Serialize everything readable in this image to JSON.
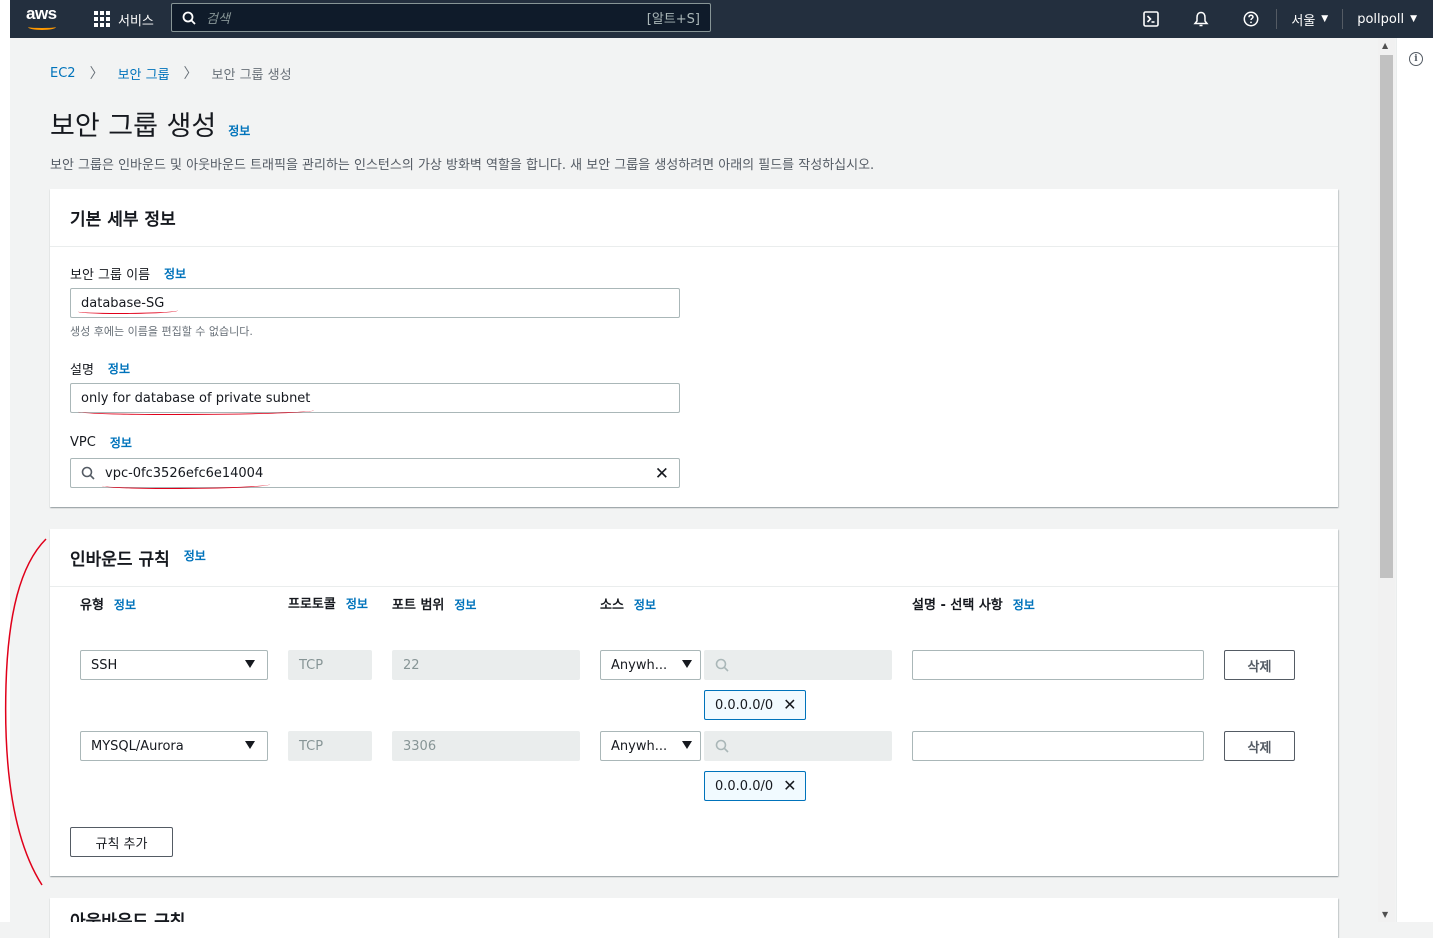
{
  "topbar": {
    "logo": "aws",
    "services_label": "서비스",
    "search_placeholder": "검색",
    "search_shortcut": "[알트+S]",
    "region": "서울",
    "user": "pollpoll"
  },
  "breadcrumb": {
    "root": "EC2",
    "parent": "보안 그룹",
    "current": "보안 그룹 생성"
  },
  "page": {
    "title": "보안 그룹 생성",
    "info": "정보",
    "description": "보안 그룹은 인바운드 및 아웃바운드 트래픽을 관리하는 인스턴스의 가상 방화벽 역할을 합니다. 새 보안 그룹을 생성하려면 아래의 필드를 작성하십시오."
  },
  "basic": {
    "title": "기본 세부 정보",
    "name_label": "보안 그룹 이름",
    "name_value": "database-SG",
    "name_hint": "생성 후에는 이름을 편집할 수 없습니다.",
    "desc_label": "설명",
    "desc_value": "only for database of private subnet",
    "vpc_label": "VPC",
    "vpc_value": "vpc-0fc3526efc6e14004",
    "info": "정보"
  },
  "inbound": {
    "title": "인바운드 규칙",
    "info": "정보",
    "columns": {
      "type": "유형",
      "protocol": "프로토콜",
      "port": "포트 범위",
      "source": "소스",
      "description": "설명 - 선택 사항"
    },
    "rules": [
      {
        "type": "SSH",
        "protocol": "TCP",
        "port": "22",
        "source": "Anywh...",
        "cidr": "0.0.0.0/0",
        "delete": "삭제"
      },
      {
        "type": "MYSQL/Aurora",
        "protocol": "TCP",
        "port": "3306",
        "source": "Anywh...",
        "cidr": "0.0.0.0/0",
        "delete": "삭제"
      }
    ],
    "add_rule": "규칙 추가"
  },
  "outbound": {
    "title": "아웃바운드 규칙"
  },
  "colors": {
    "nav_bg": "#232f3e",
    "link": "#0073bb",
    "annotation": "#e0001a",
    "aws_orange": "#ff9900"
  }
}
